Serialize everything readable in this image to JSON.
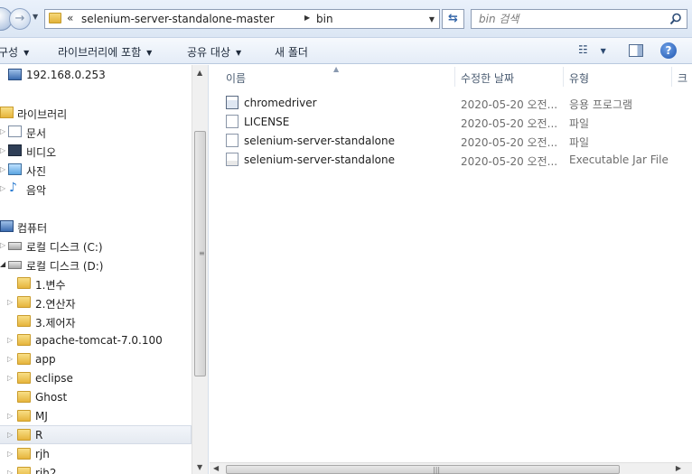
{
  "address": {
    "chevron": "«",
    "segments": [
      "selenium-server-standalone-master",
      "bin"
    ]
  },
  "search": {
    "placeholder": "bin 검색"
  },
  "toolbar": {
    "organize": "구성",
    "include_in_library": "라이브러리에 포함",
    "share_with": "공유 대상",
    "new_folder": "새 폴더"
  },
  "nav": {
    "network_item": "192.168.0.253",
    "libraries": "라이브러리",
    "documents": "문서",
    "videos": "비디오",
    "pictures": "사진",
    "music": "음악",
    "computer": "컴퓨터",
    "drive_c": "로컬 디스크 (C:)",
    "drive_d": "로컬 디스크 (D:)",
    "folders": [
      "1.변수",
      "2.연산자",
      "3.제어자",
      "apache-tomcat-7.0.100",
      "app",
      "eclipse",
      "Ghost",
      "MJ",
      "R",
      "rjh",
      "rjh2"
    ]
  },
  "columns": {
    "name": "이름",
    "date_modified": "수정한 날짜",
    "type": "유형",
    "size": "크"
  },
  "files": [
    {
      "name": "chromedriver",
      "date": "2020-05-20 오전...",
      "type": "응용 프로그램",
      "icon": "application-icon"
    },
    {
      "name": "LICENSE",
      "date": "2020-05-20 오전...",
      "type": "파일",
      "icon": "file-icon"
    },
    {
      "name": "selenium-server-standalone",
      "date": "2020-05-20 오전...",
      "type": "파일",
      "icon": "file-icon"
    },
    {
      "name": "selenium-server-standalone",
      "date": "2020-05-20 오전...",
      "type": "Executable Jar File",
      "icon": "jar-file-icon"
    }
  ]
}
